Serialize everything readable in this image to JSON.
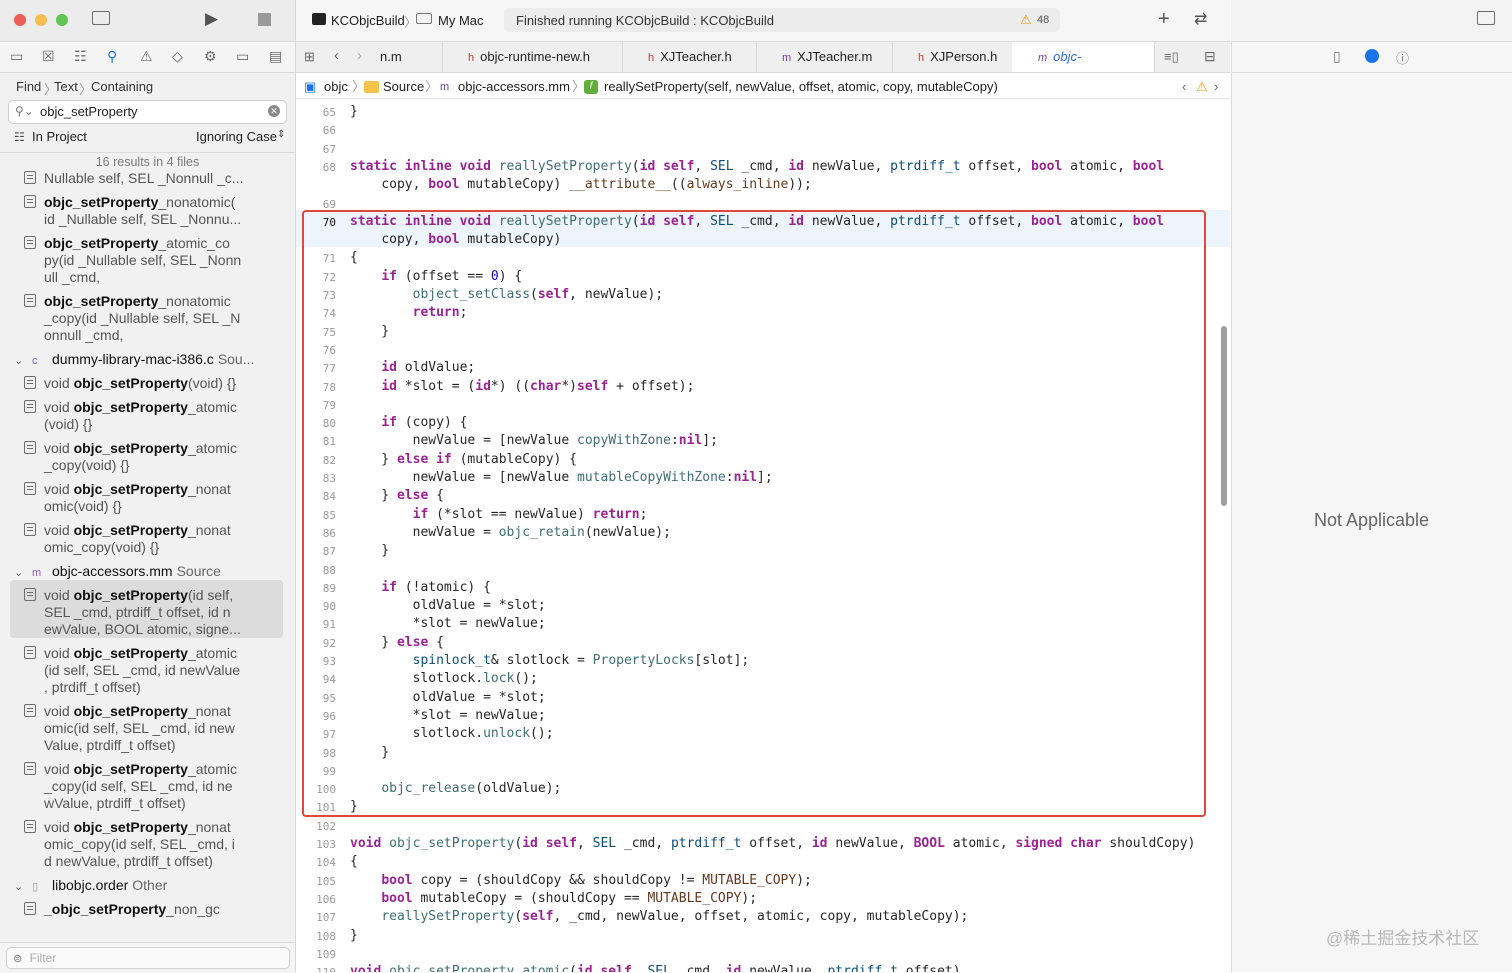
{
  "toolbar": {
    "scheme": "KCObjcBuild",
    "destination": "My Mac",
    "status": "Finished running KCObjcBuild : KCObjcBuild",
    "warning_count": "48"
  },
  "find": {
    "path": [
      "Find",
      "Text",
      "Containing"
    ],
    "query": "objc_setProperty",
    "scope": "In Project",
    "case_mode": "Ignoring Case",
    "results_summary": "16 results in 4 files",
    "filter_placeholder": "Filter"
  },
  "results": [
    {
      "pre": "",
      "bold": "",
      "rest": "Nullable self, SEL _Nonnull _c..."
    },
    {
      "pre": "",
      "bold": "objc_setProperty",
      "rest": "_nonatomic(",
      "cont": [
        "id _Nullable self, SEL _Nonnu..."
      ]
    },
    {
      "pre": "",
      "bold": "objc_setProperty",
      "rest": "_atomic_co",
      "cont": [
        "py(id _Nullable self, SEL _Nonn",
        "ull _cmd,"
      ]
    },
    {
      "pre": "",
      "bold": "objc_setProperty",
      "rest": "_nonatomic",
      "cont": [
        "_copy(id _Nullable self, SEL _N",
        "onnull _cmd,"
      ]
    },
    {
      "group": true,
      "name": "dummy-library-mac-i386.c",
      "src": "Sou...",
      "icon": "c"
    },
    {
      "pre": "void ",
      "bold": "objc_setProperty",
      "rest": "(void) {}"
    },
    {
      "pre": "void ",
      "bold": "objc_setProperty",
      "rest": "_atomic",
      "cont": [
        "(void) {}"
      ]
    },
    {
      "pre": "void ",
      "bold": "objc_setProperty",
      "rest": "_atomic",
      "cont": [
        "_copy(void) {}"
      ]
    },
    {
      "pre": "void ",
      "bold": "objc_setProperty",
      "rest": "_nonat",
      "cont": [
        "omic(void) {}"
      ]
    },
    {
      "pre": "void ",
      "bold": "objc_setProperty",
      "rest": "_nonat",
      "cont": [
        "omic_copy(void) {}"
      ]
    },
    {
      "group": true,
      "name": "objc-accessors.mm",
      "src": "Source",
      "icon": "m"
    },
    {
      "pre": "void ",
      "bold": "objc_setProperty",
      "rest": "(id self,",
      "cont": [
        "SEL _cmd, ptrdiff_t offset, id n",
        "ewValue, BOOL atomic, signe..."
      ],
      "selected": true
    },
    {
      "pre": "void ",
      "bold": "objc_setProperty",
      "rest": "_atomic",
      "cont": [
        "(id self, SEL _cmd, id newValue",
        ", ptrdiff_t offset)"
      ]
    },
    {
      "pre": "void ",
      "bold": "objc_setProperty",
      "rest": "_nonat",
      "cont": [
        "omic(id self, SEL _cmd, id new",
        "Value, ptrdiff_t offset)"
      ]
    },
    {
      "pre": "void ",
      "bold": "objc_setProperty",
      "rest": "_atomic",
      "cont": [
        "_copy(id self, SEL _cmd, id ne",
        "wValue, ptrdiff_t offset)"
      ]
    },
    {
      "pre": "void ",
      "bold": "objc_setProperty",
      "rest": "_nonat",
      "cont": [
        "omic_copy(id self, SEL _cmd, i",
        "d newValue, ptrdiff_t offset)"
      ]
    },
    {
      "group": true,
      "name": "libobjc.order",
      "src": "Other",
      "icon": ""
    },
    {
      "pre": "",
      "bold": "_objc_setProperty",
      "rest": "_non_gc"
    }
  ],
  "tabs": [
    {
      "type": "",
      "label": "n.m"
    },
    {
      "type": "h",
      "label": "objc-runtime-new.h"
    },
    {
      "type": "h",
      "label": "XJTeacher.h"
    },
    {
      "type": "m",
      "label": "XJTeacher.m"
    },
    {
      "type": "h",
      "label": "XJPerson.h"
    },
    {
      "type": "m",
      "label": "objc-accessors.m"
    }
  ],
  "jumpbar": {
    "project": "objc",
    "folder": "Source",
    "file": "objc-accessors.mm",
    "symbol": "reallySetProperty(self, newValue, offset, atomic, copy, mutableCopy)"
  },
  "code_lines": [
    {
      "n": "65",
      "t": "}"
    },
    {
      "n": "66",
      "t": ""
    },
    {
      "n": "67",
      "t": ""
    },
    {
      "n": "68",
      "t": "static inline void reallySetProperty(id self, SEL _cmd, id newValue, ptrdiff_t offset, bool atomic, bool"
    },
    {
      "n": "",
      "t": "    copy, bool mutableCopy) __attribute__((always_inline));"
    },
    {
      "n": "69",
      "t": ""
    },
    {
      "n": "70",
      "t": "static inline void reallySetProperty(id self, SEL _cmd, id newValue, ptrdiff_t offset, bool atomic, bool"
    },
    {
      "n": "",
      "t": "    copy, bool mutableCopy)"
    },
    {
      "n": "71",
      "t": "{"
    },
    {
      "n": "72",
      "t": "    if (offset == 0) {"
    },
    {
      "n": "73",
      "t": "        object_setClass(self, newValue);"
    },
    {
      "n": "74",
      "t": "        return;"
    },
    {
      "n": "75",
      "t": "    }"
    },
    {
      "n": "76",
      "t": ""
    },
    {
      "n": "77",
      "t": "    id oldValue;"
    },
    {
      "n": "78",
      "t": "    id *slot = (id*) ((char*)self + offset);"
    },
    {
      "n": "79",
      "t": ""
    },
    {
      "n": "80",
      "t": "    if (copy) {"
    },
    {
      "n": "81",
      "t": "        newValue = [newValue copyWithZone:nil];"
    },
    {
      "n": "82",
      "t": "    } else if (mutableCopy) {"
    },
    {
      "n": "83",
      "t": "        newValue = [newValue mutableCopyWithZone:nil];"
    },
    {
      "n": "84",
      "t": "    } else {"
    },
    {
      "n": "85",
      "t": "        if (*slot == newValue) return;"
    },
    {
      "n": "86",
      "t": "        newValue = objc_retain(newValue);"
    },
    {
      "n": "87",
      "t": "    }"
    },
    {
      "n": "88",
      "t": ""
    },
    {
      "n": "89",
      "t": "    if (!atomic) {"
    },
    {
      "n": "90",
      "t": "        oldValue = *slot;"
    },
    {
      "n": "91",
      "t": "        *slot = newValue;"
    },
    {
      "n": "92",
      "t": "    } else {"
    },
    {
      "n": "93",
      "t": "        spinlock_t& slotlock = PropertyLocks[slot];"
    },
    {
      "n": "94",
      "t": "        slotlock.lock();"
    },
    {
      "n": "95",
      "t": "        oldValue = *slot;"
    },
    {
      "n": "96",
      "t": "        *slot = newValue;"
    },
    {
      "n": "97",
      "t": "        slotlock.unlock();"
    },
    {
      "n": "98",
      "t": "    }"
    },
    {
      "n": "99",
      "t": ""
    },
    {
      "n": "100",
      "t": "    objc_release(oldValue);"
    },
    {
      "n": "101",
      "t": "}"
    },
    {
      "n": "102",
      "t": ""
    },
    {
      "n": "103",
      "t": "void objc_setProperty(id self, SEL _cmd, ptrdiff_t offset, id newValue, BOOL atomic, signed char shouldCopy)"
    },
    {
      "n": "104",
      "t": "{"
    },
    {
      "n": "105",
      "t": "    bool copy = (shouldCopy && shouldCopy != MUTABLE_COPY);"
    },
    {
      "n": "106",
      "t": "    bool mutableCopy = (shouldCopy == MUTABLE_COPY);"
    },
    {
      "n": "107",
      "t": "    reallySetProperty(self, _cmd, newValue, offset, atomic, copy, mutableCopy);"
    },
    {
      "n": "108",
      "t": "}"
    },
    {
      "n": "109",
      "t": ""
    },
    {
      "n": "110",
      "t": "void objc_setProperty_atomic(id self, SEL _cmd, id newValue, ptrdiff_t offset)"
    }
  ],
  "inspector": {
    "empty_message": "Not Applicable"
  },
  "watermark": "@稀土掘金技术社区",
  "colors": {
    "highlight_box": "#e0473f",
    "accent": "#1a73e8",
    "keyword": "#9b2393"
  }
}
